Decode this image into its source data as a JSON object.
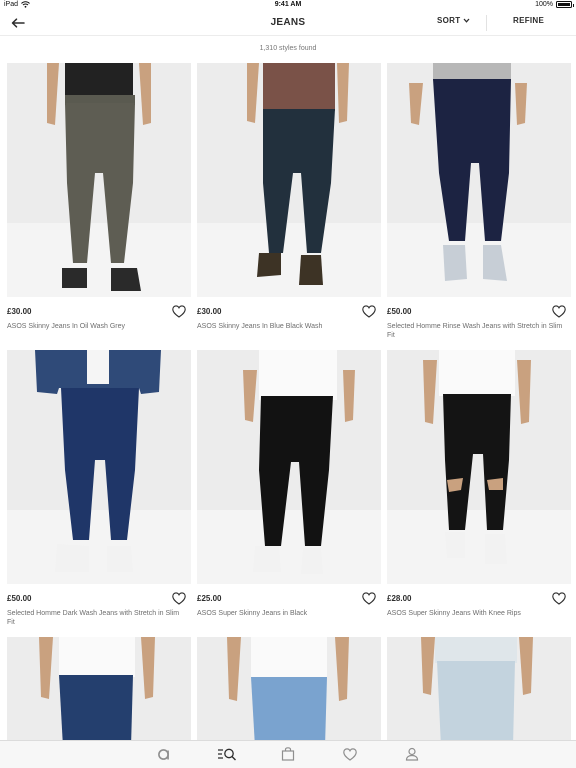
{
  "status_bar": {
    "device": "iPad",
    "time": "9:41 AM",
    "battery": "100%",
    "battery_level": 1.0
  },
  "nav": {
    "title": "JEANS",
    "sort_label": "SORT",
    "refine_label": "REFINE"
  },
  "results_count": "1,310 styles found",
  "products": [
    {
      "price": "£30.00",
      "name": "ASOS Skinny Jeans In Oil Wash Grey"
    },
    {
      "price": "£30.00",
      "name": "ASOS Skinny Jeans In Blue Black Wash"
    },
    {
      "price": "£50.00",
      "name": "Selected Homme Rinse Wash Jeans with Stretch in Slim Fit"
    },
    {
      "price": "£50.00",
      "name": "Selected Homme Dark Wash Jeans with Stretch in Slim Fit"
    },
    {
      "price": "£25.00",
      "name": "ASOS Super Skinny Jeans in Black"
    },
    {
      "price": "£28.00",
      "name": "ASOS Super Skinny Jeans With Knee Rips"
    }
  ],
  "tabs": [
    "home-icon",
    "search-icon",
    "bag-icon",
    "saved-icon",
    "account-icon"
  ],
  "colors": {
    "text": "#2d2d2d",
    "secondary_text": "#6e6e6e",
    "photo_bg": "#ececec",
    "tab_bar_bg": "#f7f7f7"
  }
}
